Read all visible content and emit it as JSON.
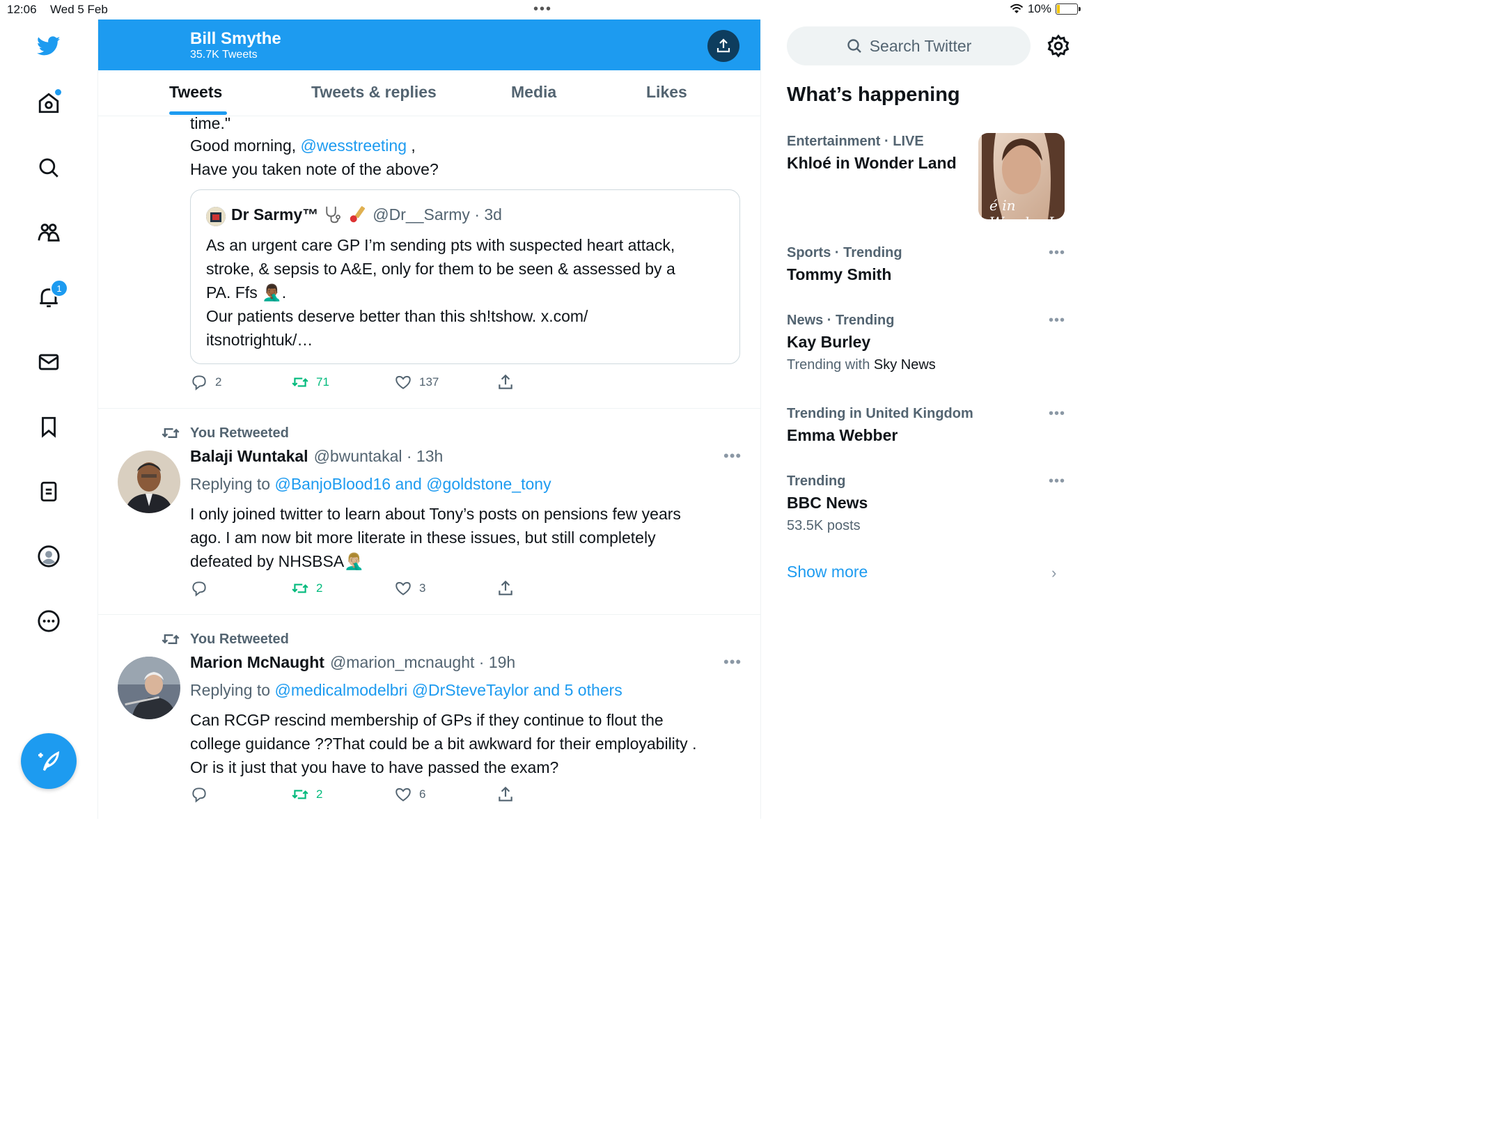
{
  "status": {
    "time": "12:06",
    "date": "Wed 5 Feb",
    "dots": "•••",
    "battery": "10%"
  },
  "nav": {
    "notif_badge": "1"
  },
  "profile": {
    "name": "Bill Smythe",
    "tweet_count": "35.7K Tweets"
  },
  "tabs": [
    {
      "label": "Tweets"
    },
    {
      "label": "Tweets & replies"
    },
    {
      "label": "Media"
    },
    {
      "label": "Likes"
    }
  ],
  "tweet1": {
    "line1": "time.\"",
    "line2_pre": "Good morning, ",
    "line2_mention": "@wesstreeting",
    "line2_post": " ,",
    "line3": "Have you taken note of the above?",
    "quote": {
      "name": "Dr Sarmy™",
      "handle_time": "@Dr__Sarmy · 3d",
      "text1": "As an urgent care GP I’m sending pts with suspected heart attack,",
      "text2": "stroke, & sepsis to A&E, only for them to be seen & assessed by a",
      "text3": "PA. Ffs 🤦🏾‍♂️.",
      "text4": "Our patients deserve better than this sh!tshow. x.com/",
      "text5": "itsnotrightuk/…"
    },
    "replies": "2",
    "retweets": "71",
    "likes": "137"
  },
  "tweet2": {
    "retweet_label": "You Retweeted",
    "name": "Balaji Wuntakal",
    "handle_time": "@bwuntakal · 13h",
    "replying_prefix": "Replying to ",
    "replying_to": "@BanjoBlood16 and @goldstone_tony",
    "text1": "I only joined twitter to learn about Tony’s posts on pensions few years",
    "text2": "ago. I am now bit more literate in these issues, but still completely",
    "text3": "defeated by NHSBSA🤦🏼‍♂️",
    "replies": "",
    "retweets": "2",
    "likes": "3"
  },
  "tweet3": {
    "retweet_label": "You Retweeted",
    "name": "Marion McNaught",
    "handle_time": "@marion_mcnaught · 19h",
    "replying_prefix": "Replying to ",
    "replying_to": "@medicalmodelbri @DrSteveTaylor and 5 others",
    "text1": "Can RCGP rescind membership of GPs if they continue to flout the",
    "text2": "college guidance ??That could be a bit awkward for their employability .",
    "text3": "Or is it just that you have to have passed the exam?",
    "replies": "",
    "retweets": "2",
    "likes": "6"
  },
  "search": {
    "placeholder": "Search Twitter"
  },
  "whats_happening": "What’s happening",
  "trends": [
    {
      "meta": "Entertainment · LIVE",
      "name": "Khloé in Wonder Land"
    },
    {
      "meta": "Sports · Trending",
      "name": "Tommy Smith"
    },
    {
      "meta": "News · Trending",
      "name": "Kay Burley",
      "extra_prefix": "Trending with ",
      "extra_name": "Sky News"
    },
    {
      "meta": "Trending in United Kingdom",
      "name": "Emma Webber"
    },
    {
      "meta": "Trending",
      "name": "BBC News",
      "extra": "53.5K posts"
    }
  ],
  "show_more": "Show more",
  "thumb_caption": "é in Wonder L",
  "colors": {
    "accent": "#1d9bf0",
    "retweet": "#00ba7c",
    "text": "#0f1419",
    "muted": "#536471"
  }
}
